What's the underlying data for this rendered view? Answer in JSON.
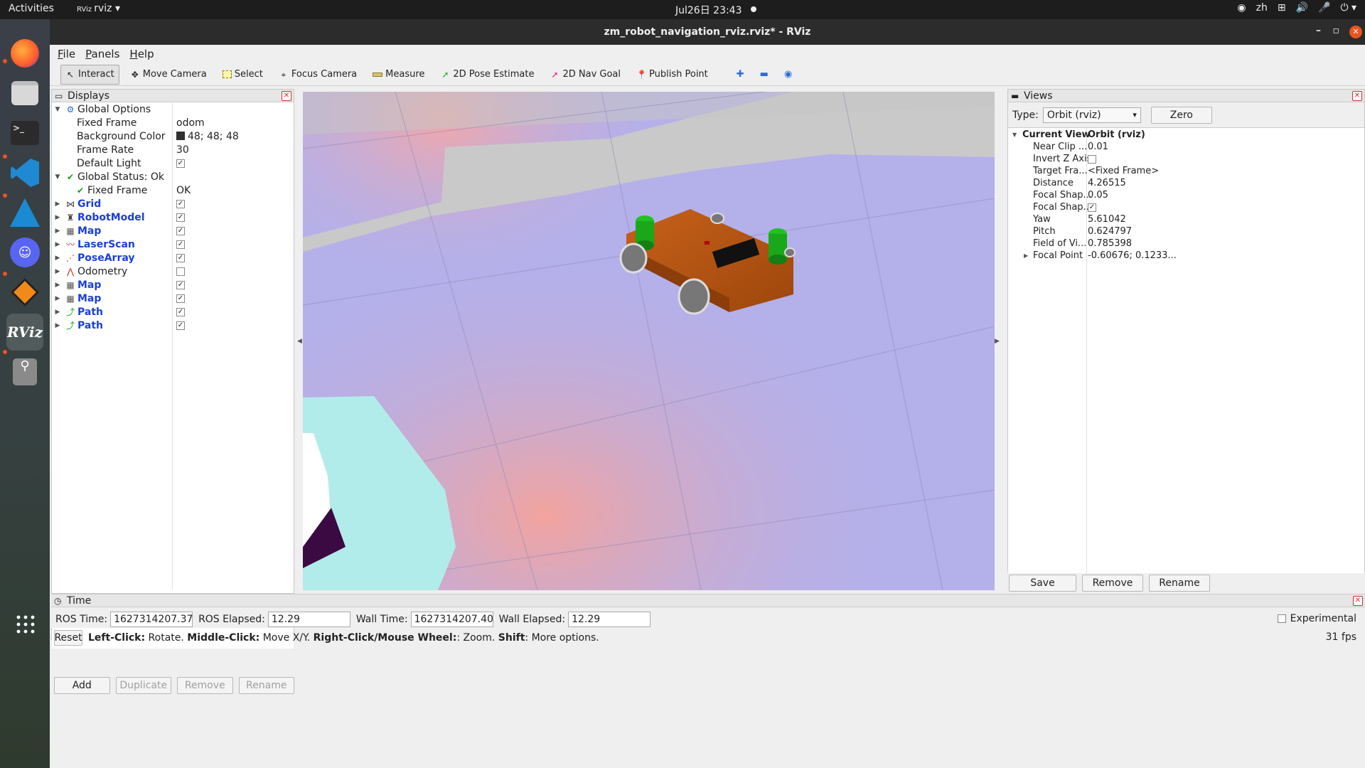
{
  "topbar": {
    "activities": "Activities",
    "app_name": "rviz",
    "clock": "Jul26日  23:43",
    "lang": "zh"
  },
  "dock": {
    "items": [
      "firefox-icon",
      "files-icon",
      "terminal-icon",
      "vscode-icon",
      "cmake-icon",
      "discord-icon",
      "stack-icon",
      "rviz-icon",
      "usb-icon",
      "apps-grid-icon"
    ],
    "rviz_label": "RViz"
  },
  "window": {
    "title": "zm_robot_navigation_rviz.rviz* - RViz"
  },
  "menu": {
    "file": "File",
    "panels": "Panels",
    "help": "Help"
  },
  "toolbar": {
    "interact": "Interact",
    "move_camera": "Move Camera",
    "select": "Select",
    "focus_camera": "Focus Camera",
    "measure": "Measure",
    "pose_estimate": "2D Pose Estimate",
    "nav_goal": "2D Nav Goal",
    "publish_point": "Publish Point"
  },
  "displays": {
    "title": "Displays",
    "global_options": "Global Options",
    "fixed_frame_label": "Fixed Frame",
    "fixed_frame_value": "odom",
    "bg_color_label": "Background Color",
    "bg_color_value": "48; 48; 48",
    "frame_rate_label": "Frame Rate",
    "frame_rate_value": "30",
    "default_light_label": "Default Light",
    "global_status": "Global Status: Ok",
    "status_fixed_frame_label": "Fixed Frame",
    "status_fixed_frame_value": "OK",
    "items": [
      {
        "label": "Grid",
        "checked": "✓",
        "icon": "grid-icon"
      },
      {
        "label": "RobotModel",
        "checked": "✓",
        "icon": "robot-model-icon"
      },
      {
        "label": "Map",
        "checked": "✓",
        "icon": "map-icon"
      },
      {
        "label": "LaserScan",
        "checked": "✓",
        "icon": "laserscan-icon"
      },
      {
        "label": "PoseArray",
        "checked": "✓",
        "icon": "posearray-icon"
      },
      {
        "label": "Odometry",
        "checked": "",
        "icon": "odometry-icon"
      },
      {
        "label": "Map",
        "checked": "✓",
        "icon": "map-icon"
      },
      {
        "label": "Map",
        "checked": "✓",
        "icon": "map-icon"
      },
      {
        "label": "Path",
        "checked": "✓",
        "icon": "path-icon"
      },
      {
        "label": "Path",
        "checked": "✓",
        "icon": "path-icon"
      }
    ],
    "buttons": {
      "add": "Add",
      "duplicate": "Duplicate",
      "remove": "Remove",
      "rename": "Rename"
    }
  },
  "views": {
    "title": "Views",
    "type_label": "Type:",
    "type_value": "Orbit (rviz)",
    "zero": "Zero",
    "current_view": "Current View",
    "current_view_value": "Orbit (rviz)",
    "props": [
      {
        "label": "Near Clip ...",
        "value": "0.01"
      },
      {
        "label": "Invert Z Axis",
        "value": ""
      },
      {
        "label": "Target Fra...",
        "value": "<Fixed Frame>"
      },
      {
        "label": "Distance",
        "value": "4.26515"
      },
      {
        "label": "Focal Shap...",
        "value": "0.05"
      },
      {
        "label": "Focal Shap...",
        "value": "✓"
      },
      {
        "label": "Yaw",
        "value": "5.61042"
      },
      {
        "label": "Pitch",
        "value": "0.624797"
      },
      {
        "label": "Field of Vi...",
        "value": "0.785398"
      },
      {
        "label": "Focal Point",
        "value": "-0.60676; 0.1233..."
      }
    ],
    "buttons": {
      "save": "Save",
      "remove": "Remove",
      "rename": "Rename"
    }
  },
  "time": {
    "title": "Time",
    "ros_time_label": "ROS Time:",
    "ros_time": "1627314207.37",
    "ros_elapsed_label": "ROS Elapsed:",
    "ros_elapsed": "12.29",
    "wall_time_label": "Wall Time:",
    "wall_time": "1627314207.40",
    "wall_elapsed_label": "Wall Elapsed:",
    "wall_elapsed": "12.29",
    "experimental": "Experimental"
  },
  "status": {
    "reset": "Reset",
    "b1": "Left-Click:",
    "t1": "Rotate.",
    "b2": "Middle-Click:",
    "t2": "Move X/Y.",
    "b3": "Right-Click/Mouse Wheel:",
    "t3": ": Zoom.",
    "b4": "Shift",
    "t4": ": More options.",
    "fps": "31 fps"
  },
  "colors": {
    "map_floor": "#b4b0ea",
    "chassis": "#b9520f",
    "lidar": "#1fb31f",
    "costmap": "#b2ecea"
  }
}
